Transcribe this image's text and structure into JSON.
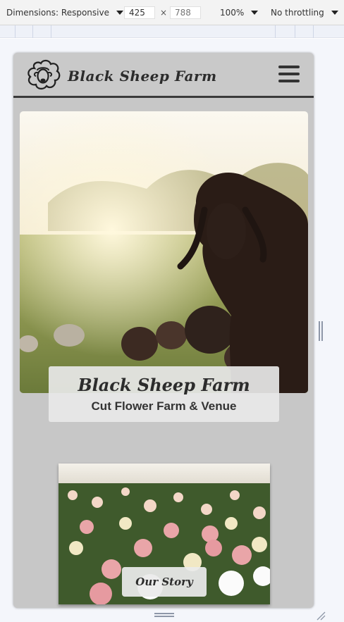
{
  "devtools": {
    "dimensions_label": "Dimensions: Responsive",
    "width_value": "425",
    "height_placeholder": "788",
    "times_symbol": "×",
    "zoom_label": "100%",
    "throttle_label": "No throttling"
  },
  "site": {
    "brand_name": "Black Sheep Farm",
    "hero_title": "Black Sheep Farm",
    "hero_subtitle": "Cut Flower Farm & Venue",
    "story_button_label": "Our Story"
  },
  "icons": {
    "logo": "sheep-logo-icon",
    "menu": "hamburger-menu-icon",
    "dropdown": "caret-down-icon",
    "resize": "resize-grip-icon"
  },
  "colors": {
    "header_bg": "#c9c9c9",
    "header_border": "#3a3a3a",
    "text_dark": "#2c2c2c",
    "page_bg": "#c7c7c7"
  }
}
